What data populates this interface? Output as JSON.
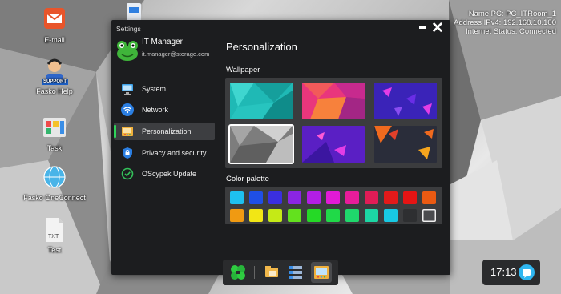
{
  "desktop": {
    "icons": [
      {
        "label": "E-mail",
        "icon": "email-icon"
      },
      {
        "label": "",
        "icon": "document-icon"
      },
      {
        "label": "Fasko Help",
        "icon": "support-icon",
        "badge": "SUPPORT"
      },
      {
        "label": "Task",
        "icon": "task-board-icon"
      },
      {
        "label": "Fasko OneConnect",
        "icon": "network-globe-icon"
      },
      {
        "label": "Test",
        "icon": "txt-file-icon",
        "badge": "TXT"
      }
    ],
    "netinfo": {
      "line1": "Name PC: PC_ITRoom_1",
      "line2": "Address IPv4: 192.168.10.100",
      "line3": "Internet Status: Connected"
    }
  },
  "settings": {
    "title": "Settings",
    "user": {
      "name": "IT Manager",
      "email": "it.manager@storage.com"
    },
    "nav": [
      {
        "label": "System",
        "icon": "monitor-icon",
        "active": false
      },
      {
        "label": "Network",
        "icon": "wifi-icon",
        "active": false
      },
      {
        "label": "Personalization",
        "icon": "palette-icon",
        "active": true
      },
      {
        "label": "Privacy and security",
        "icon": "lock-shield-icon",
        "active": false
      },
      {
        "label": "OScypek Update",
        "icon": "check-circle-icon",
        "active": false
      }
    ],
    "panel": {
      "title": "Personalization",
      "wallpaper_label": "Wallpaper",
      "selected_wallpaper": 4,
      "palette_label": "Color palette",
      "palette_row1": [
        "#1ec0ef",
        "#1f4fe6",
        "#3a2fe0",
        "#8a25e3",
        "#b21ee6",
        "#e21ad6",
        "#e81c9a",
        "#e11c56",
        "#e31a1a",
        "#e51414",
        "#ea5a12"
      ],
      "palette_row2": [
        "#f09a12",
        "#f2e615",
        "#c5ea16",
        "#63e11e",
        "#25d926",
        "#20d948",
        "#1fd86c",
        "#1cd6a4",
        "#18c9e3",
        "#2e2f31",
        "#4a4b4e"
      ],
      "selected_color": 21
    }
  },
  "taskbar": {
    "items": [
      {
        "name": "start-menu-icon",
        "active": false
      },
      {
        "name": "file-explorer-icon",
        "active": false
      },
      {
        "name": "task-manager-icon",
        "active": false
      },
      {
        "name": "settings-app-icon",
        "active": true
      }
    ]
  },
  "clock": {
    "time": "17:13"
  }
}
